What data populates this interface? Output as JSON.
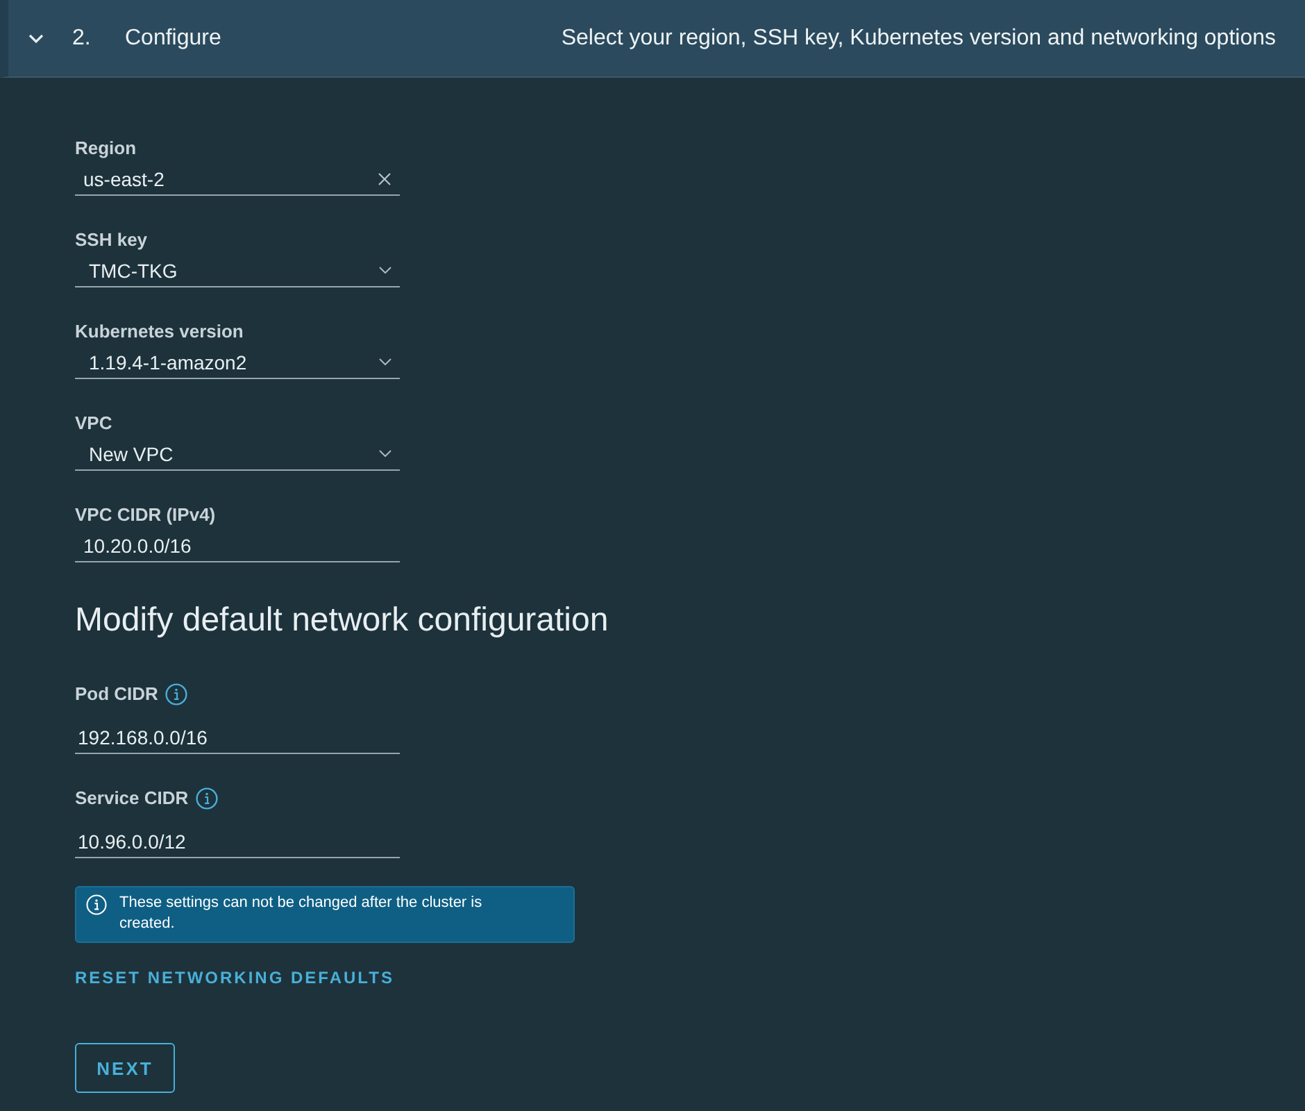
{
  "header": {
    "expanded": true,
    "step": "2.",
    "title": "Configure",
    "description": "Select your region, SSH key, Kubernetes version and networking options"
  },
  "fields": [
    {
      "kind": "combobox",
      "label": "Region",
      "value": "us-east-2",
      "info": false
    },
    {
      "kind": "select",
      "label": "SSH key",
      "value": "TMC-TKG",
      "info": false
    },
    {
      "kind": "select",
      "label": "Kubernetes version",
      "value": "1.19.4-1-amazon2",
      "info": false
    },
    {
      "kind": "select",
      "label": "VPC",
      "value": "New VPC",
      "info": false
    },
    {
      "kind": "text",
      "label": "VPC CIDR (IPv4)",
      "value": "10.20.0.0/16",
      "info": false
    }
  ],
  "network": {
    "heading": "Modify default network configuration",
    "fields": [
      {
        "kind": "text",
        "label": "Pod CIDR",
        "value": "192.168.0.0/16",
        "info": true
      },
      {
        "kind": "text",
        "label": "Service CIDR",
        "value": "10.96.0.0/12",
        "info": true
      }
    ],
    "alert": {
      "text": "These settings can not be changed after the cluster is created."
    },
    "reset_link": "RESET NETWORKING DEFAULTS"
  },
  "next_button": "NEXT"
}
